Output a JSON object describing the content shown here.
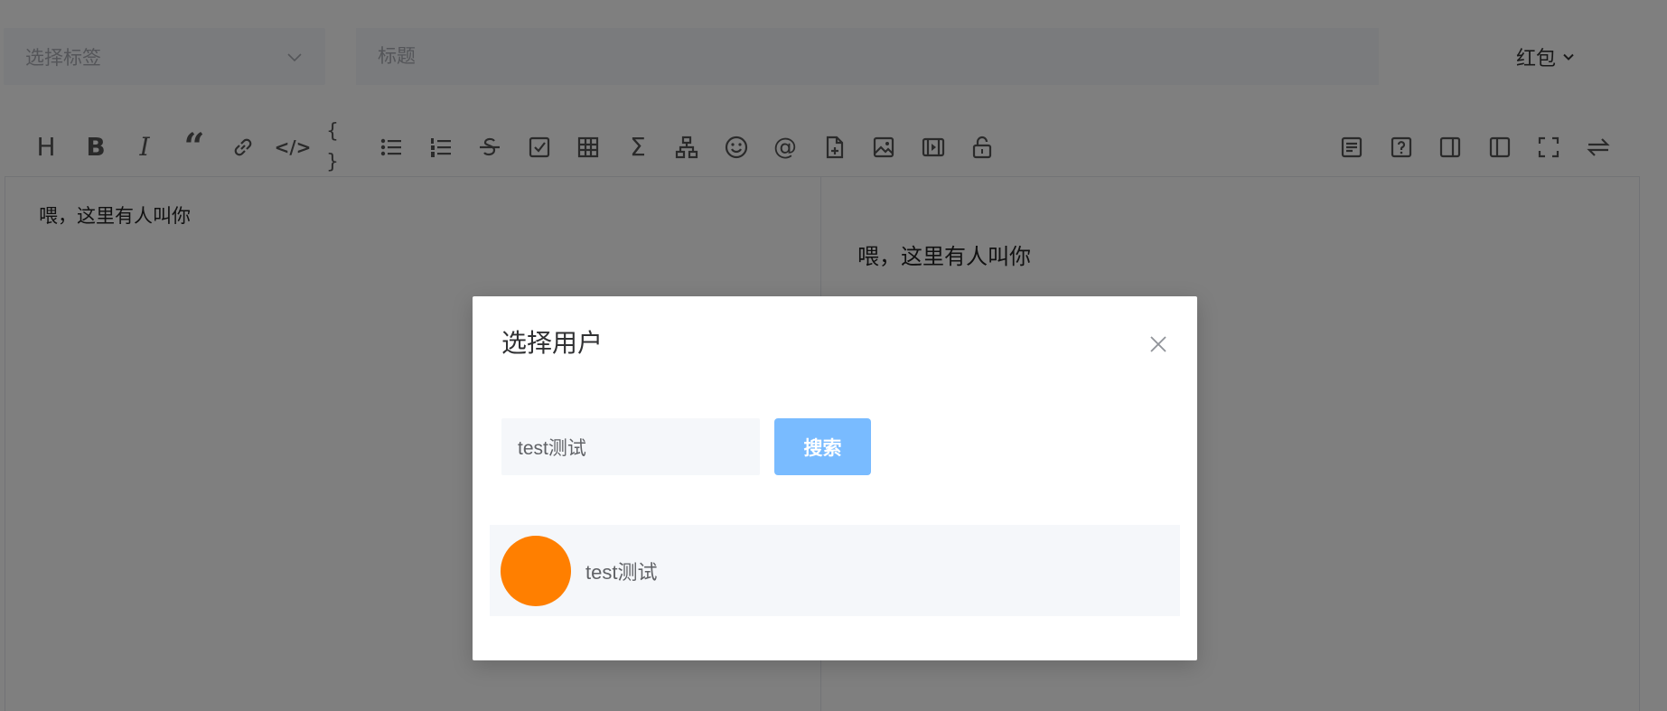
{
  "header": {
    "tag_select_placeholder": "选择标签",
    "title_placeholder": "标题",
    "redpacket_label": "红包"
  },
  "toolbar": {
    "left_icons": [
      "heading-icon",
      "bold-icon",
      "italic-icon",
      "quote-icon",
      "link-icon",
      "inline-code-icon",
      "code-block-icon",
      "bullet-list-icon",
      "ordered-list-icon",
      "strikethrough-icon",
      "checklist-icon",
      "table-icon",
      "formula-icon",
      "diagram-icon",
      "emoji-icon",
      "mention-icon",
      "file-icon",
      "image-icon",
      "video-icon",
      "lock-icon"
    ],
    "right_icons": [
      "summary-icon",
      "help-icon",
      "preview-right-icon",
      "preview-left-icon",
      "fullscreen-icon",
      "switch-icon"
    ],
    "heading_glyph": "H",
    "bold_glyph": "B",
    "italic_glyph": "I",
    "quote_glyph": "“",
    "inline_code_glyph": "</>",
    "code_block_glyph": "{ }",
    "mention_glyph": "@",
    "formula_glyph": "Σ"
  },
  "editor": {
    "content": "喂，这里有人叫你"
  },
  "preview": {
    "content": "喂，这里有人叫你"
  },
  "modal": {
    "title": "选择用户",
    "search_value": "test测试",
    "search_button_label": "搜索",
    "users": [
      {
        "name": "test测试",
        "avatar_color": "#ff7f00"
      }
    ]
  },
  "colors": {
    "overlay": "rgba(0,0,0,0.5)",
    "search_button": "#79bbff",
    "input_bg": "#f5f7fa",
    "avatar": "#ff7f00"
  }
}
